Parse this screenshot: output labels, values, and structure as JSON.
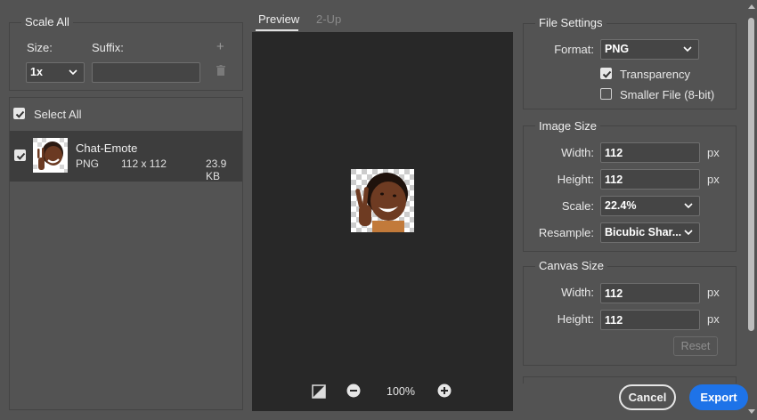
{
  "scale_all": {
    "title": "Scale All",
    "size_label": "Size:",
    "suffix_label": "Suffix:",
    "size_value": "1x",
    "suffix_value": ""
  },
  "assets": {
    "select_all_label": "Select All",
    "items": [
      {
        "name": "Chat-Emote",
        "format": "PNG",
        "dimensions": "112 x 112",
        "filesize": "23.9 KB"
      }
    ]
  },
  "preview": {
    "tabs": [
      "Preview",
      "2-Up"
    ],
    "zoom": "100%"
  },
  "file_settings": {
    "title": "File Settings",
    "format_label": "Format:",
    "format_value": "PNG",
    "transparency_label": "Transparency",
    "smaller_file_label": "Smaller File (8-bit)"
  },
  "image_size": {
    "title": "Image Size",
    "width_label": "Width:",
    "width_value": "112",
    "height_label": "Height:",
    "height_value": "112",
    "scale_label": "Scale:",
    "scale_value": "22.4%",
    "resample_label": "Resample:",
    "resample_value": "Bicubic Shar...",
    "unit": "px"
  },
  "canvas_size": {
    "title": "Canvas Size",
    "width_label": "Width:",
    "width_value": "112",
    "height_label": "Height:",
    "height_value": "112",
    "unit": "px",
    "reset_label": "Reset"
  },
  "buttons": {
    "cancel": "Cancel",
    "export": "Export"
  },
  "colors": {
    "background": "#535353",
    "canvas": "#282828",
    "accent": "#1e73e8"
  }
}
